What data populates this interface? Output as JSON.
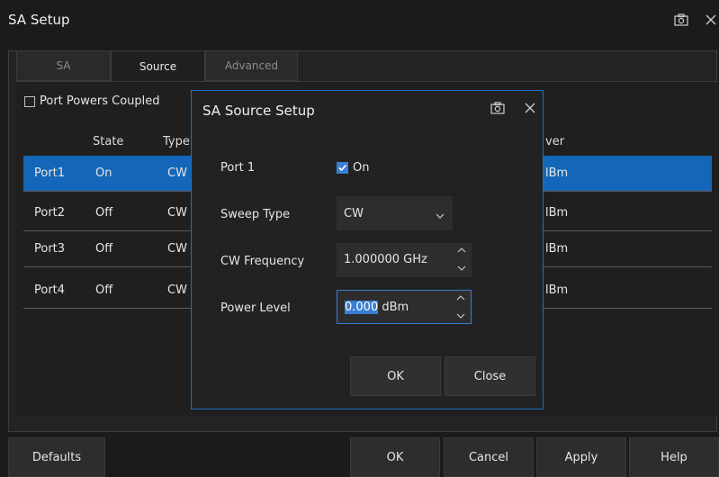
{
  "window": {
    "title": "SA Setup"
  },
  "tabs": [
    {
      "label": "SA",
      "active": false
    },
    {
      "label": "Source",
      "active": true
    },
    {
      "label": "Advanced",
      "active": false
    }
  ],
  "port_powers_coupled": {
    "label": "Port Powers Coupled",
    "checked": false
  },
  "table": {
    "headers": {
      "state": "State",
      "type": "Type",
      "power": "ver"
    },
    "rows": [
      {
        "port": "Port1",
        "state": "On",
        "type": "CW",
        "power": "lBm",
        "selected": true
      },
      {
        "port": "Port2",
        "state": "Off",
        "type": "CW",
        "power": "lBm",
        "selected": false
      },
      {
        "port": "Port3",
        "state": "Off",
        "type": "CW",
        "power": "lBm",
        "selected": false
      },
      {
        "port": "Port4",
        "state": "Off",
        "type": "CW",
        "power": "lBm",
        "selected": false
      }
    ]
  },
  "buttons": {
    "defaults": "Defaults",
    "ok": "OK",
    "cancel": "Cancel",
    "apply": "Apply",
    "help": "Help"
  },
  "dialog": {
    "title": "SA Source Setup",
    "port_label": "Port 1",
    "port_on_label": "On",
    "port_on_checked": true,
    "sweep_type_label": "Sweep Type",
    "sweep_type_value": "CW",
    "cw_frequency_label": "CW Frequency",
    "cw_frequency_value": "1.000000 GHz",
    "power_level_label": "Power Level",
    "power_level_selected": "0.000",
    "power_level_unit": " dBm",
    "ok": "OK",
    "close": "Close"
  },
  "colors": {
    "accent": "#1467b8",
    "dialog_border": "#1e6fc4",
    "background": "#1b1b1b"
  }
}
